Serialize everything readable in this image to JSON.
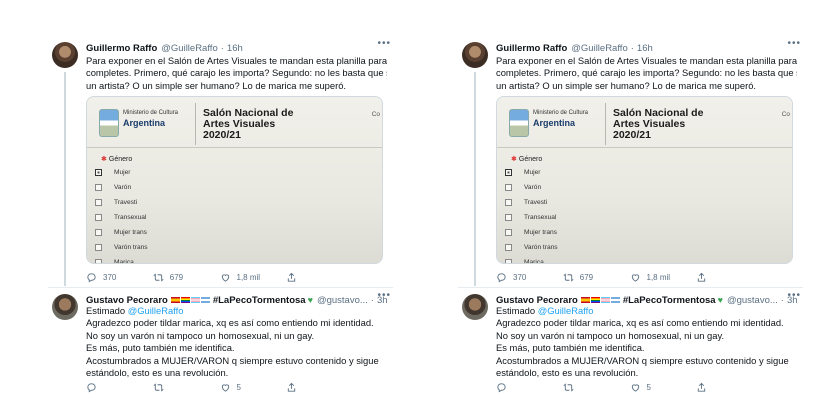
{
  "panels": [
    {
      "main": {
        "name": "Guillermo Raffo",
        "handle": "@GuilleRaffo",
        "time": "16h",
        "lines": [
          "Para exponer en el Salón de Artes Visuales te mandan esta planilla para que",
          "completes. Primero, qué carajo les importa? Segundo: no les basta que sea",
          "un artista? O un simple ser humano? Lo de marica me superó."
        ],
        "media": {
          "ministerio": "Ministerio de Cultura",
          "argentina": "Argentina",
          "salon_lines": [
            "Salón Nacional de",
            "Artes Visuales",
            "2020/21"
          ],
          "corner": "Co",
          "field_label": "Género",
          "options": [
            "Mujer",
            "Varón",
            "Travesti",
            "Transexual",
            "Mujer trans",
            "Varón trans",
            "Marica"
          ]
        },
        "counts": {
          "replies": "370",
          "retweets": "679",
          "likes": "",
          "views": "1,8 mil"
        }
      },
      "reply": {
        "name": "Gustavo Pecoraro",
        "hashtag": "#LaPecoTormentosa",
        "handle": "@gustavo...",
        "time": "3h",
        "replying_prefix": "Estimado",
        "replying_to": "@GuilleRaffo",
        "lines": [
          "Agradezco poder tildar marica, xq es así como entiendo mi identidad.",
          "No soy un varón ni tampoco un homosexual, ni un gay.",
          "Es más, puto también me identifica.",
          "Acostumbrados a MUJER/VARON q siempre estuvo contenido y sigue",
          "estándolo, esto es una revolución."
        ],
        "counts": {
          "replies": "",
          "retweets": "",
          "likes": "5"
        }
      }
    },
    {
      "main": {
        "name": "Guillermo Raffo",
        "handle": "@GuilleRaffo",
        "time": "16h",
        "lines": [
          "Para exponer en el Salón de Artes Visuales te mandan esta planilla para que",
          "completes. Primero, qué carajo les importa? Segundo: no les basta que sea",
          "un artista? O un simple ser humano? Lo de marica me superó."
        ],
        "media": {
          "ministerio": "Ministerio de Cultura",
          "argentina": "Argentina",
          "salon_lines": [
            "Salón Nacional de",
            "Artes Visuales",
            "2020/21"
          ],
          "corner": "Co",
          "field_label": "Género",
          "options": [
            "Mujer",
            "Varón",
            "Travesti",
            "Transexual",
            "Mujer trans",
            "Varón trans",
            "Marica"
          ]
        },
        "counts": {
          "replies": "370",
          "retweets": "679",
          "likes": "",
          "views": "1,8 mil"
        }
      },
      "reply": {
        "name": "Gustavo Pecoraro",
        "hashtag": "#LaPecoTormentosa",
        "handle": "@gustavo...",
        "time": "3h",
        "replying_prefix": "Estimado",
        "replying_to": "@GuilleRaffo",
        "lines": [
          "Agradezco poder tildar marica, xq es así como entiendo mi identidad.",
          "No soy un varón ni tampoco un homosexual, ni un gay.",
          "Es más, puto también me identifica.",
          "Acostumbrados a MUJER/VARON q siempre estuvo contenido y sigue",
          "estándolo, esto es una revolución."
        ],
        "counts": {
          "replies": "",
          "retweets": "",
          "likes": "5"
        }
      }
    }
  ],
  "icons": {
    "reply": "reply-icon",
    "retweet": "retweet-icon",
    "like": "heart-icon",
    "views": "chart-icon",
    "share": "share-icon",
    "more": "more-icon"
  }
}
